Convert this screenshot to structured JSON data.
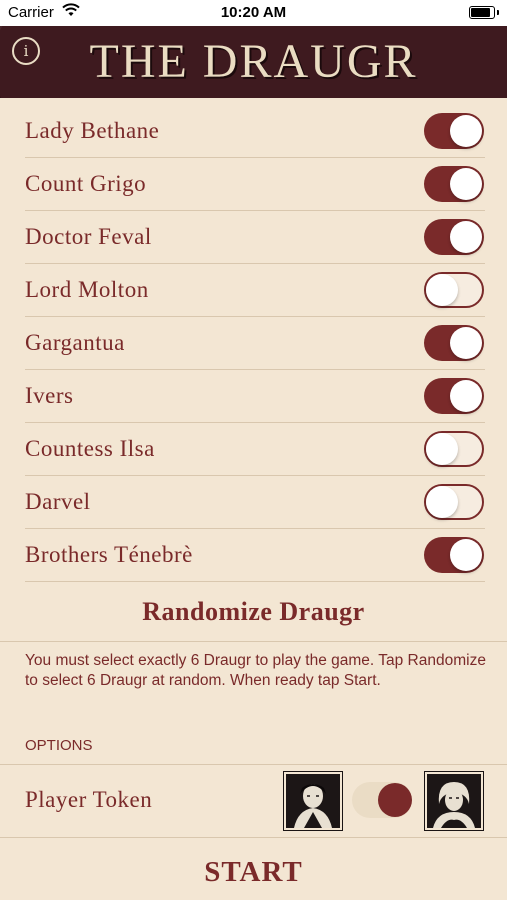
{
  "status_bar": {
    "carrier": "Carrier",
    "time": "10:20 AM",
    "wifi_icon": "wifi-icon",
    "battery_icon": "battery-icon"
  },
  "header": {
    "title": "THE DRAUGR",
    "info_glyph": "i"
  },
  "draugr": [
    {
      "name": "Lady Bethane",
      "on": true
    },
    {
      "name": "Count Grigo",
      "on": true
    },
    {
      "name": "Doctor Feval",
      "on": true
    },
    {
      "name": "Lord Molton",
      "on": false
    },
    {
      "name": "Gargantua",
      "on": true
    },
    {
      "name": "Ivers",
      "on": true
    },
    {
      "name": "Countess Ilsa",
      "on": false
    },
    {
      "name": "Darvel",
      "on": false
    },
    {
      "name": "Brothers Ténebrè",
      "on": true
    }
  ],
  "randomize_label": "Randomize Draugr",
  "instructions": "You must select exactly 6 Draugr to play the game. Tap Randomize to select 6 Draugr at random. When ready tap Start.",
  "options_heading": "OPTIONS",
  "player_token": {
    "label": "Player Token",
    "selected": "right"
  },
  "start_label": "START",
  "colors": {
    "accent": "#7a2a2a",
    "background": "#f3e6d3",
    "header": "#3e1a1f"
  }
}
